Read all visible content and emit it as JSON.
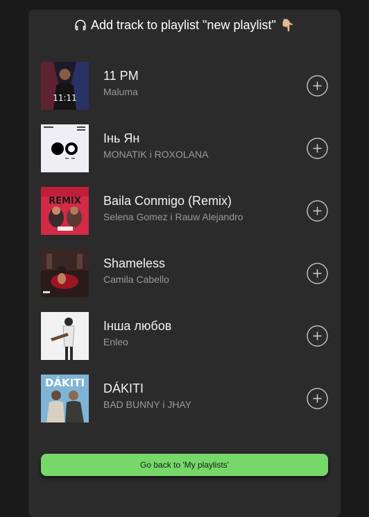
{
  "header": {
    "title": "Add track to playlist \"new playlist\"",
    "headphones_icon": "headphones-icon",
    "hand_emoji": "👇🏼"
  },
  "tracks": [
    {
      "title": "11 PM",
      "artist": "Maluma",
      "cover": "11-pm-cover",
      "cover_text": "11:11"
    },
    {
      "title": "Інь Ян",
      "artist": "MONATIK і ROXOLANA",
      "cover": "in-yan-cover",
      "cover_text": ""
    },
    {
      "title": "Baila Conmigo (Remix)",
      "artist": "Selena Gomez і Rauw Alejandro",
      "cover": "baila-conmigo-cover",
      "cover_text": "REMIX"
    },
    {
      "title": "Shameless",
      "artist": "Camila Cabello",
      "cover": "shameless-cover",
      "cover_text": ""
    },
    {
      "title": "Інша любов",
      "artist": "Enleo",
      "cover": "insha-lyubov-cover",
      "cover_text": ""
    },
    {
      "title": "DÁKITI",
      "artist": "BAD BUNNY і JHAY",
      "cover": "dakiti-cover",
      "cover_text": "DÁKITI"
    }
  ],
  "add_icon": "plus-circle-icon",
  "back_button": {
    "label": "Go back to 'My playlists'"
  },
  "colors": {
    "background": "#1a1a1a",
    "panel": "#2b2b2b",
    "accent": "#77d86a"
  }
}
